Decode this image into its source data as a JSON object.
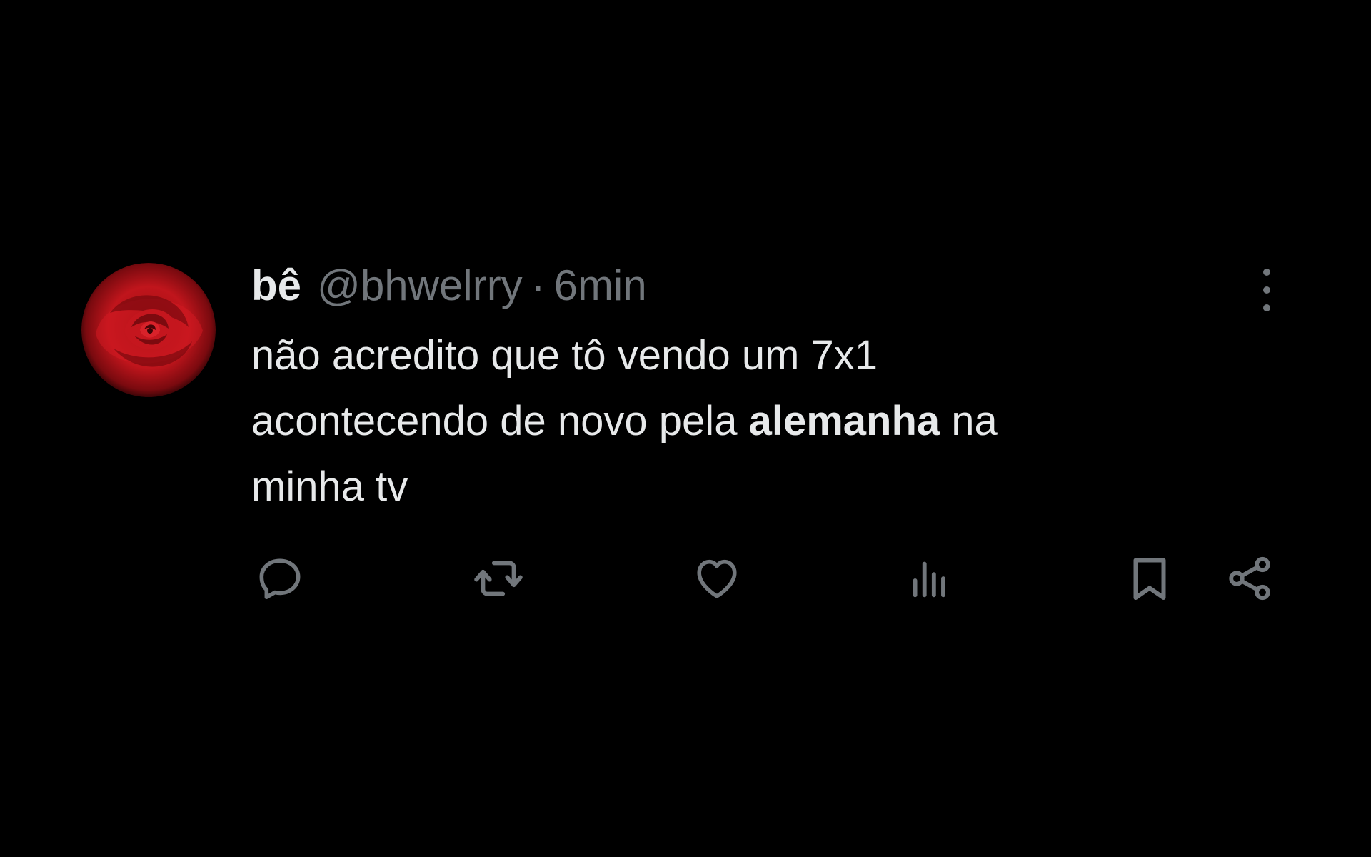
{
  "tweet": {
    "author": {
      "display_name": "bê",
      "handle": "@bhwelrry",
      "avatar_icon": "red-rose-avatar"
    },
    "separator": "·",
    "time": "6min",
    "text": {
      "line1": "não acredito que tô vendo um 7x1",
      "line2_before": "acontecendo de novo pela",
      "line2_bold": "alemanha",
      "line2_after": "na",
      "line3": "minha tv"
    },
    "actions": [
      {
        "icon": "reply-icon"
      },
      {
        "icon": "retweet-icon"
      },
      {
        "icon": "like-icon"
      },
      {
        "icon": "views-icon"
      },
      {
        "icon": "bookmark-icon"
      },
      {
        "icon": "share-icon"
      }
    ],
    "menu_icon": "more-options-icon"
  },
  "colors": {
    "background": "#000000",
    "primary_text": "#e7e9ea",
    "secondary_text": "#71767b",
    "rose": "#b3121a"
  }
}
